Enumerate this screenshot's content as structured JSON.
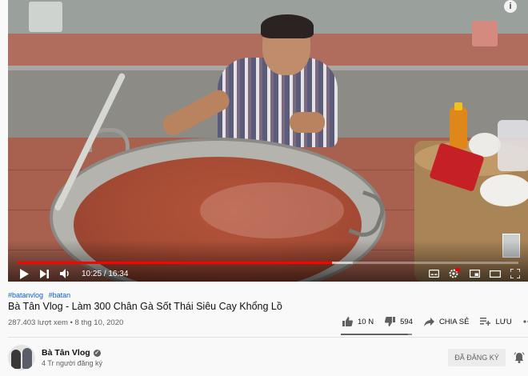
{
  "player": {
    "time_current": "10:25",
    "time_separator": "/",
    "time_total": "16:34",
    "progress": 0.628,
    "buffered": 0.67,
    "accent": "#ff0000"
  },
  "video": {
    "hashtags": [
      "#batanvlog",
      "#batan"
    ],
    "title": "Bà Tân Vlog - Làm 300 Chân Gà Sốt Thái Siêu Cay Khổng Lồ",
    "views": "287.403 lượt xem",
    "separator": "•",
    "date": "8 thg 10, 2020"
  },
  "actions": {
    "like_count": "10 N",
    "dislike_count": "594",
    "share_label": "CHIA SẺ",
    "save_label": "LƯU",
    "like_ratio": 0.94
  },
  "channel": {
    "name": "Bà Tân Vlog",
    "subscribers": "4 Tr người đăng ký",
    "subscribe_label": "ĐÃ ĐĂNG KÝ"
  },
  "icons": {
    "info": "i",
    "verified": "✓"
  },
  "colors": {
    "link": "#065fd4",
    "text": "#0f0f0f",
    "muted": "#606060"
  }
}
